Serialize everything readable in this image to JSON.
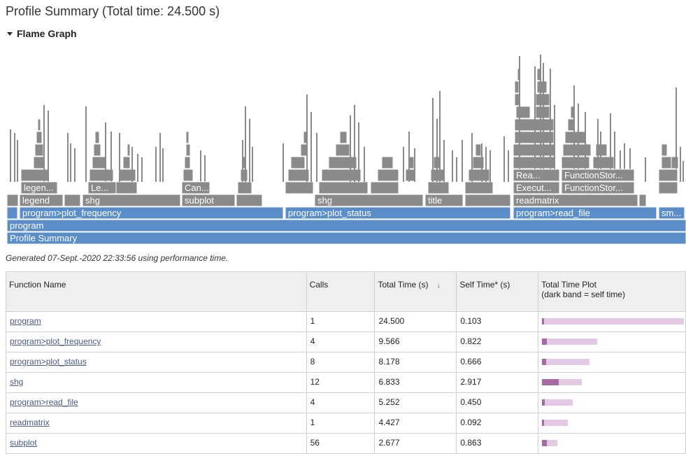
{
  "page": {
    "title": "Profile Summary (Total time: 24.500 s)",
    "flame_graph_label": "Flame Graph",
    "generated_text": "Generated 07-Sept.-2020 22:33:56 using performance time."
  },
  "flame": {
    "bars": [
      {
        "label": "Profile Summary"
      },
      {
        "label": "program"
      },
      {
        "label": "program>plot_frequency"
      },
      {
        "label": "program>plot_status"
      },
      {
        "label": "program>read_file"
      },
      {
        "label": "sm..."
      },
      {
        "label": "legend"
      },
      {
        "label": "shg"
      },
      {
        "label": "subplot"
      },
      {
        "label": "shg"
      },
      {
        "label": "title"
      },
      {
        "label": "readmatrix"
      },
      {
        "label": "legen..."
      },
      {
        "label": "Le..."
      },
      {
        "label": "Can..."
      },
      {
        "label": "Execut..."
      },
      {
        "label": "FunctionStor..."
      },
      {
        "label": "Rea..."
      },
      {
        "label": "FunctionStor..."
      }
    ]
  },
  "table": {
    "headers": {
      "function_name": "Function Name",
      "calls": "Calls",
      "total_time": "Total Time (s)",
      "sort_indicator": "↓",
      "self_time": "Self Time* (s)",
      "plot_title": "Total Time Plot",
      "plot_subtitle": "(dark band = self time)"
    },
    "rows": [
      {
        "name": "program",
        "calls": "1",
        "total": "24.500",
        "self": "0.103",
        "total_v": 24.5,
        "self_v": 0.103
      },
      {
        "name": "program>plot_frequency",
        "calls": "4",
        "total": "9.566",
        "self": "0.822",
        "total_v": 9.566,
        "self_v": 0.822
      },
      {
        "name": "program>plot_status",
        "calls": "8",
        "total": "8.178",
        "self": "0.666",
        "total_v": 8.178,
        "self_v": 0.666
      },
      {
        "name": "shg",
        "calls": "12",
        "total": "6.833",
        "self": "2.917",
        "total_v": 6.833,
        "self_v": 2.917
      },
      {
        "name": "program>read_file",
        "calls": "4",
        "total": "5.252",
        "self": "0.450",
        "total_v": 5.252,
        "self_v": 0.45
      },
      {
        "name": "readmatrix",
        "calls": "1",
        "total": "4.427",
        "self": "0.092",
        "total_v": 4.427,
        "self_v": 0.092
      },
      {
        "name": "subplot",
        "calls": "56",
        "total": "2.677",
        "self": "0.863",
        "total_v": 2.677,
        "self_v": 0.863
      }
    ]
  },
  "colors": {
    "flame_blue": "#5b8ec8",
    "flame_gray": "#8a8a8a",
    "plot_total": "#e3c9e3",
    "plot_self": "#a56ba5"
  }
}
